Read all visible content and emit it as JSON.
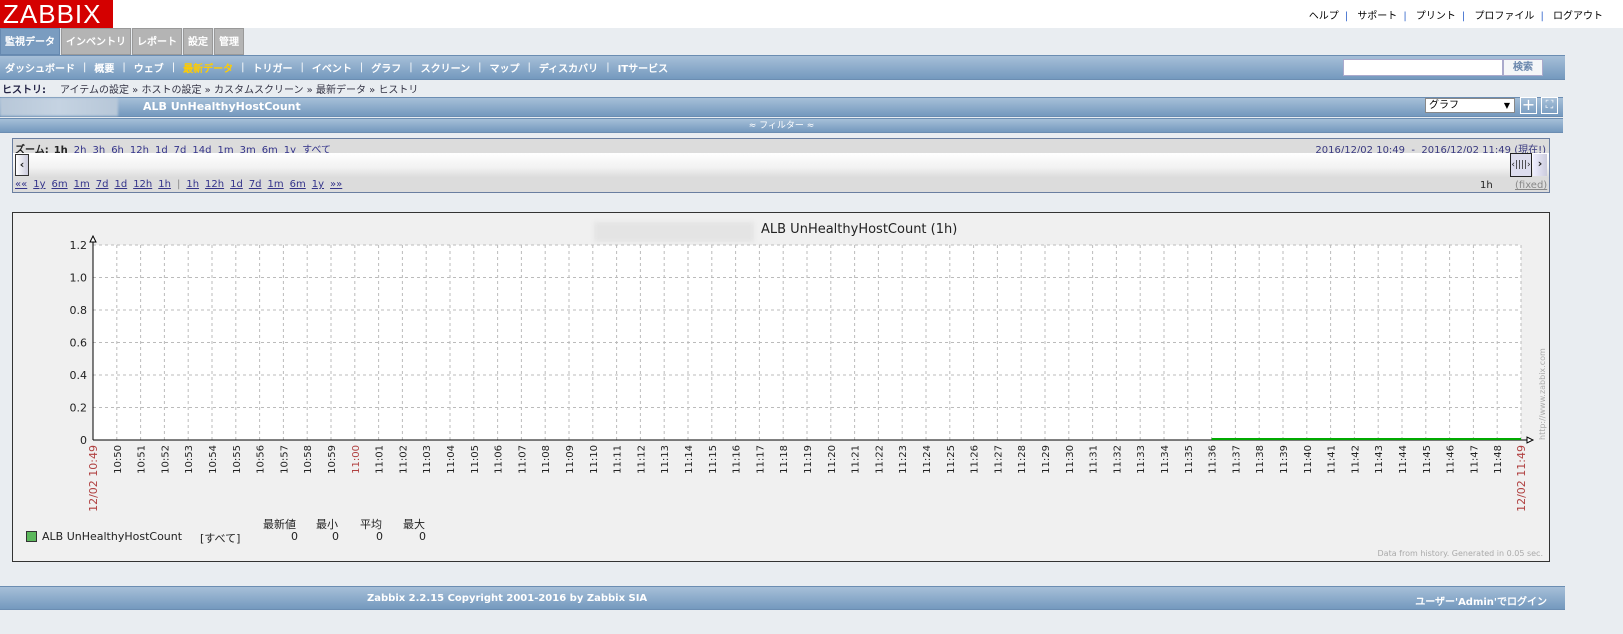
{
  "header": {
    "logo": "ZABBIX",
    "links": [
      "ヘルプ",
      "サポート",
      "プリント",
      "プロファイル",
      "ログアウト"
    ]
  },
  "tabs": [
    "監視データ",
    "インベントリ",
    "レポート",
    "設定",
    "管理"
  ],
  "nav": [
    "ダッシュボード",
    "概要",
    "ウェブ",
    "最新データ",
    "トリガー",
    "イベント",
    "グラフ",
    "スクリーン",
    "マップ",
    "ディスカバリ",
    "ITサービス"
  ],
  "search": {
    "button": "検索",
    "value": ""
  },
  "breadcrumb": {
    "label": "ヒストリ:",
    "items": [
      "アイテムの設定",
      "ホストの設定",
      "カスタムスクリーン",
      "最新データ",
      "ヒストリ"
    ]
  },
  "page": {
    "title": "ALB UnHealthyHostCount",
    "view_select": "グラフ"
  },
  "filter": "≈ フィルター ≈",
  "zoom": {
    "label": "ズーム:",
    "options": [
      "1h",
      "2h",
      "3h",
      "6h",
      "12h",
      "1d",
      "7d",
      "14d",
      "1m",
      "3m",
      "6m",
      "1y",
      "すべて"
    ],
    "from": "2016/12/02 10:49",
    "to": "2016/12/02 11:49",
    "now": "(現在!)",
    "back": [
      "««",
      "1y",
      "6m",
      "1m",
      "7d",
      "1d",
      "12h",
      "1h"
    ],
    "fwd": [
      "1h",
      "12h",
      "1d",
      "7d",
      "1m",
      "6m",
      "1y",
      "»»"
    ],
    "period": "1h",
    "fixed": "(fixed)"
  },
  "chart_data": {
    "type": "line",
    "title": "ALB UnHealthyHostCount (1h)",
    "ylim": [
      0,
      1.2
    ],
    "yticks": [
      "0",
      "0.2",
      "0.4",
      "0.6",
      "0.8",
      "1.0",
      "1.2"
    ],
    "x_start": "12/02 10:49",
    "x_end": "12/02 11:49",
    "xticks": [
      "10:50",
      "10:51",
      "10:52",
      "10:53",
      "10:54",
      "10:55",
      "10:56",
      "10:57",
      "10:58",
      "10:59",
      "11:00",
      "11:01",
      "11:02",
      "11:03",
      "11:04",
      "11:05",
      "11:06",
      "11:07",
      "11:08",
      "11:09",
      "11:10",
      "11:11",
      "11:12",
      "11:13",
      "11:14",
      "11:15",
      "11:16",
      "11:17",
      "11:18",
      "11:19",
      "11:20",
      "11:21",
      "11:22",
      "11:23",
      "11:24",
      "11:25",
      "11:26",
      "11:27",
      "11:28",
      "11:29",
      "11:30",
      "11:31",
      "11:32",
      "11:33",
      "11:34",
      "11:35",
      "11:36",
      "11:37",
      "11:38",
      "11:39",
      "11:40",
      "11:41",
      "11:42",
      "11:43",
      "11:44",
      "11:45",
      "11:46",
      "11:47",
      "11:48"
    ],
    "series": [
      {
        "name": "ALB UnHealthyHostCount",
        "color": "#00aa00",
        "x_minutes_from_start": [
          47,
          60
        ],
        "values": [
          0,
          0
        ]
      }
    ],
    "grid": true
  },
  "legend": {
    "name": "ALB UnHealthyHostCount",
    "func": "[すべて]",
    "headers": [
      "最新値",
      "最小",
      "平均",
      "最大"
    ],
    "values": [
      "0",
      "0",
      "0",
      "0"
    ],
    "color": "#5cb85c"
  },
  "graph_footer": {
    "generated": "Data from history. Generated in 0.05 sec.",
    "url": "http://www.zabbix.com"
  },
  "footer": {
    "copyright": "Zabbix 2.2.15 Copyright 2001-2016 by Zabbix SIA",
    "login": "ユーザー'Admin'でログイン"
  }
}
